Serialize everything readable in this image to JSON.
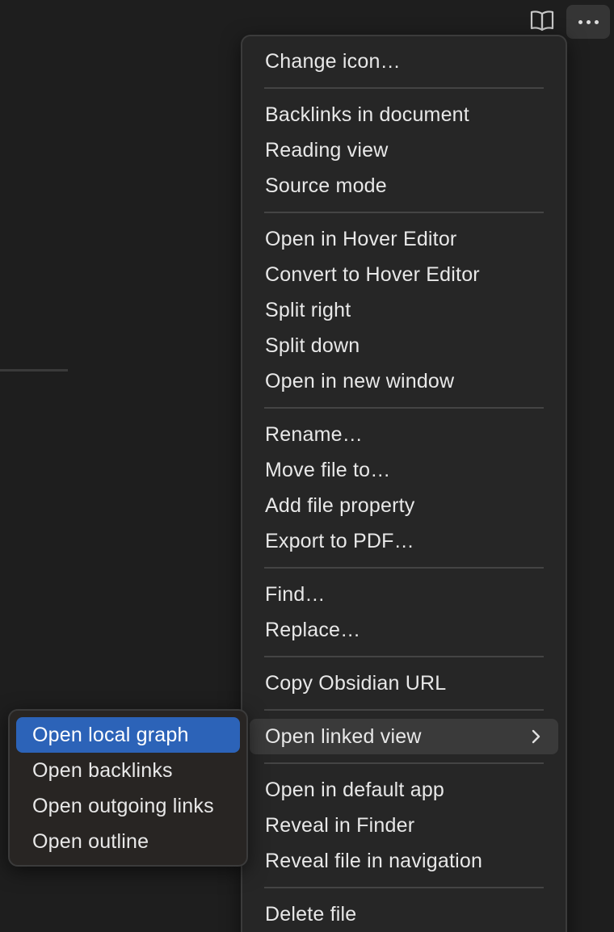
{
  "toolbar": {
    "reading_icon": "book-open-icon",
    "more_icon": "more-horizontal-icon"
  },
  "main_menu": {
    "groups": [
      {
        "items": [
          {
            "label": "Change icon…"
          }
        ]
      },
      {
        "items": [
          {
            "label": "Backlinks in document"
          },
          {
            "label": "Reading view"
          },
          {
            "label": "Source mode"
          }
        ]
      },
      {
        "items": [
          {
            "label": "Open in Hover Editor"
          },
          {
            "label": "Convert to Hover Editor"
          },
          {
            "label": "Split right"
          },
          {
            "label": "Split down"
          },
          {
            "label": "Open in new window"
          }
        ]
      },
      {
        "items": [
          {
            "label": "Rename…"
          },
          {
            "label": "Move file to…"
          },
          {
            "label": "Add file property"
          },
          {
            "label": "Export to PDF…"
          }
        ]
      },
      {
        "items": [
          {
            "label": "Find…"
          },
          {
            "label": "Replace…"
          }
        ]
      },
      {
        "items": [
          {
            "label": "Copy Obsidian URL"
          }
        ]
      },
      {
        "items": [
          {
            "label": "Open linked view",
            "submenu_icon": "chevron-right-icon",
            "active": true
          }
        ]
      },
      {
        "items": [
          {
            "label": "Open in default app"
          },
          {
            "label": "Reveal in Finder"
          },
          {
            "label": "Reveal file in navigation"
          }
        ]
      },
      {
        "items": [
          {
            "label": "Delete file"
          }
        ]
      }
    ]
  },
  "sub_menu": {
    "items": [
      {
        "label": "Open local graph",
        "highlighted": true
      },
      {
        "label": "Open backlinks"
      },
      {
        "label": "Open outgoing links"
      },
      {
        "label": "Open outline"
      }
    ]
  },
  "colors": {
    "background": "#1e1e1e",
    "menu_background": "#262626",
    "highlight": "#2c63b8",
    "text": "#e8e8e8"
  }
}
